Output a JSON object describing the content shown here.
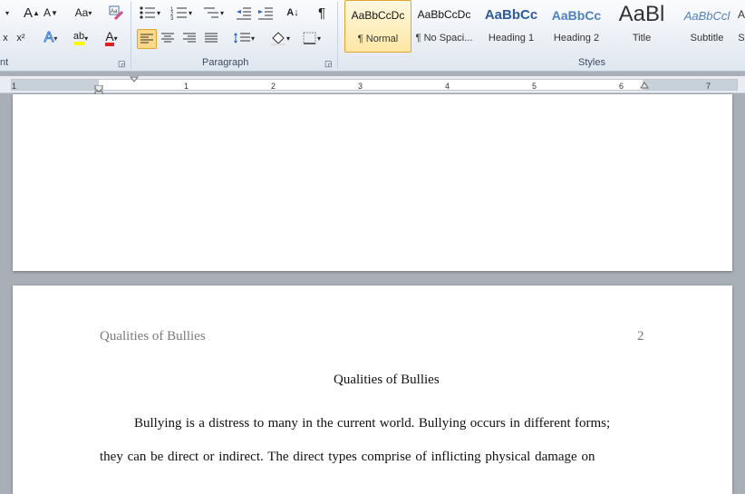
{
  "ribbon": {
    "groups": {
      "font": "nt",
      "paragraph": "Paragraph",
      "styles": "Styles"
    },
    "font_buttons": {
      "grow_font": "A",
      "shrink_font": "A",
      "change_case": "Aa",
      "subscript": "x",
      "superscript": "x²",
      "text_effects": "A",
      "highlight": "ab",
      "font_color": "A"
    },
    "paragraph_buttons": {
      "sort": "A↓",
      "show_marks": "¶"
    },
    "styles": [
      {
        "preview": "AaBbCcDc",
        "name": "¶ Normal"
      },
      {
        "preview": "AaBbCcDc",
        "name": "¶ No Spaci..."
      },
      {
        "preview": "AaBbCc",
        "name": "Heading 1"
      },
      {
        "preview": "AaBbCc",
        "name": "Heading 2"
      },
      {
        "preview": "AaBl",
        "name": "Title"
      },
      {
        "preview": "AaBbCcl",
        "name": "Subtitle"
      },
      {
        "preview": "A",
        "name": "S"
      }
    ]
  },
  "ruler": {
    "marks": [
      "1",
      "1",
      "2",
      "3",
      "4",
      "5",
      "6",
      "7"
    ]
  },
  "document": {
    "header_left": "Qualities of Bullies",
    "header_page_number": "2",
    "title": "Qualities of Bullies",
    "line1": "Bullying is a distress to many in the current world. Bullying occurs in different forms;",
    "line2": "they can be direct or indirect.  The direct types comprise of inflicting physical  damage on"
  }
}
